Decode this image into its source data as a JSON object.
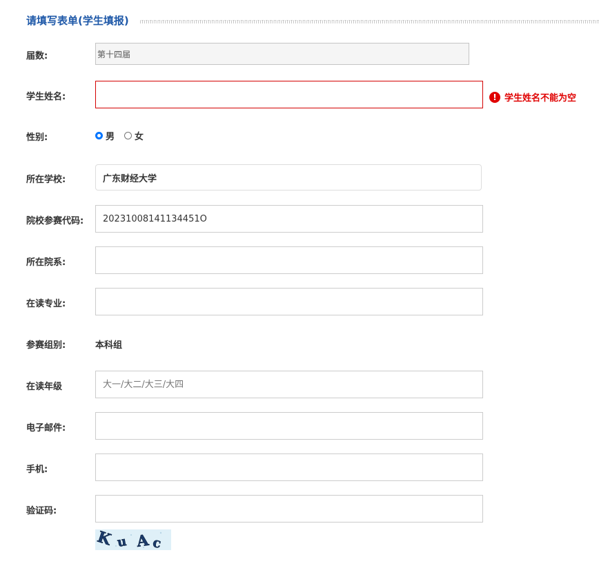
{
  "form": {
    "title": "请填写表单(学生填报)",
    "fields": {
      "session": {
        "label": "届数:",
        "value": "第十四届"
      },
      "student_name": {
        "label": "学生姓名:",
        "value": "",
        "error": "学生姓名不能为空",
        "error_icon": "!"
      },
      "gender": {
        "label": "性别:",
        "options": [
          "男",
          "女"
        ],
        "selected": "男"
      },
      "school": {
        "label": "所在学校:",
        "value": "广东财经大学"
      },
      "school_code": {
        "label": "院校参赛代码:",
        "value": "20231008141134451O"
      },
      "department": {
        "label": "所在院系:",
        "value": ""
      },
      "major": {
        "label": "在读专业:",
        "value": ""
      },
      "group": {
        "label": "参赛组别:",
        "value": "本科组"
      },
      "grade": {
        "label": "在读年级",
        "placeholder": "大一/大二/大三/大四",
        "value": ""
      },
      "email": {
        "label": "电子邮件:",
        "value": ""
      },
      "phone": {
        "label": "手机:",
        "value": ""
      },
      "captcha": {
        "label": "验证码:",
        "value": "",
        "image_text": "KuAc"
      }
    }
  },
  "colors": {
    "title": "#1e58a8",
    "error": "#e00000",
    "radio_accent": "#0075ff",
    "captcha_bg": "#dff0f8",
    "captcha_text": "#1a3a6a"
  }
}
